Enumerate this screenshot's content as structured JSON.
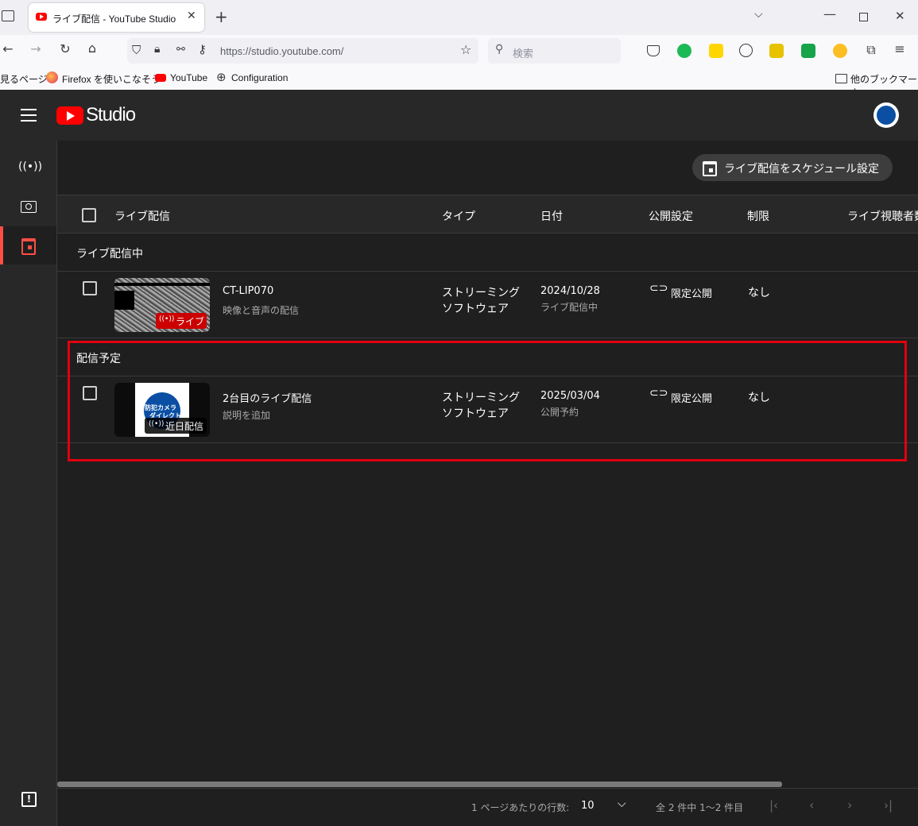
{
  "browser": {
    "tab_title": "ライブ配信 - YouTube Studio",
    "url": "https://studio.youtube.com/",
    "search_placeholder": "検索",
    "bookmarks": [
      "見るページ",
      "Firefox を使いこなそう",
      "YouTube",
      "Configuration"
    ],
    "other_bookmarks": "他のブックマーク"
  },
  "app": {
    "logo_text": "Studio",
    "schedule_button": "ライブ配信をスケジュール設定"
  },
  "table": {
    "columns": [
      "ライブ配信",
      "タイプ",
      "日付",
      "公開設定",
      "制限",
      "ライブ視聴者数"
    ],
    "sections": [
      {
        "title": "ライブ配信中",
        "rows": [
          {
            "title": "CT-LIP070",
            "description": "映像と音声の配信",
            "badge": "ライブ",
            "type": [
              "ストリーミング",
              "ソフトウェア"
            ],
            "date": "2024/10/28",
            "date_status": "ライブ配信中",
            "visibility": "限定公開",
            "restriction": "なし"
          }
        ]
      },
      {
        "title": "配信予定",
        "rows": [
          {
            "title": "2台目のライブ配信",
            "description": "説明を追加",
            "badge": "近日配信",
            "type": [
              "ストリーミング",
              "ソフトウェア"
            ],
            "date": "2025/03/04",
            "date_status": "公開予約",
            "visibility": "限定公開",
            "restriction": "なし"
          }
        ]
      }
    ]
  },
  "pagination": {
    "rows_per_page_label": "1 ページあたりの行数:",
    "rows_per_page": "10",
    "range": "全 2 件中 1〜2 件目"
  },
  "thumb2_text": [
    "防犯カメラ",
    "ダイレクト"
  ],
  "colors": {
    "accent": "#ff0000",
    "highlight_box": "#e0000f",
    "background": "#1f1f1f"
  }
}
